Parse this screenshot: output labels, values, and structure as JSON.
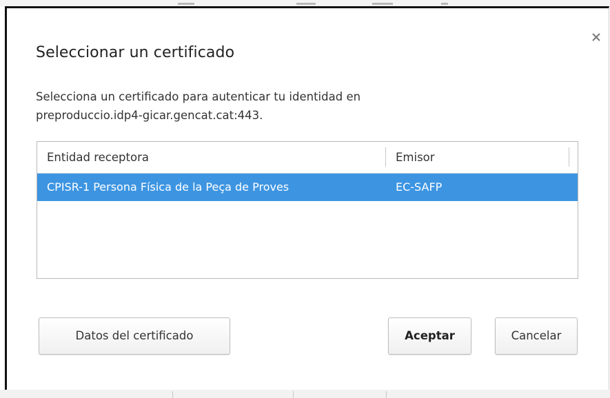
{
  "dialog": {
    "title": "Seleccionar un certificado",
    "description_line1": "Selecciona un certificado para autenticar tu identidad en",
    "description_line2": "preproduccio.idp4-gicar.gencat.cat:443.",
    "close_icon": "close-icon"
  },
  "table": {
    "columns": [
      "Entidad receptora",
      "Emisor"
    ],
    "rows": [
      {
        "subject": "CPISR-1 Persona Física de la Peça de Proves",
        "issuer": "EC-SAFP",
        "selected": true
      }
    ]
  },
  "buttons": {
    "details": "Datos del certificado",
    "accept": "Aceptar",
    "cancel": "Cancelar"
  },
  "colors": {
    "selection": "#3d95e2",
    "dialog_border": "#111111"
  }
}
